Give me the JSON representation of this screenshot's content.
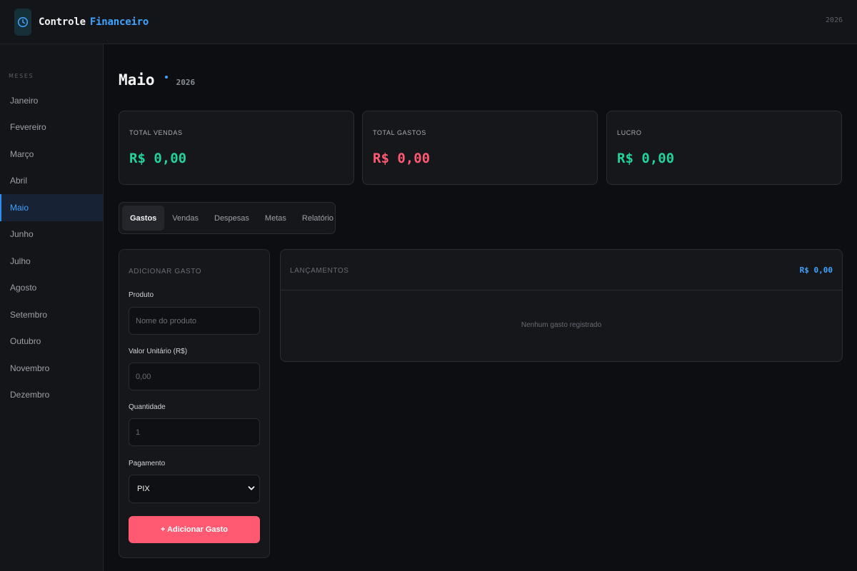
{
  "header": {
    "brand_part1": "Controle",
    "brand_part2": "Financeiro",
    "year": "2026",
    "logo_icon": "clock-icon"
  },
  "sidebar": {
    "title": "MESES",
    "months": [
      "Janeiro",
      "Fevereiro",
      "Março",
      "Abril",
      "Maio",
      "Junho",
      "Julho",
      "Agosto",
      "Setembro",
      "Outubro",
      "Novembro",
      "Dezembro"
    ],
    "active": "Maio"
  },
  "page": {
    "month": "Maio",
    "year": "2026"
  },
  "summary": {
    "vendas": {
      "label": "TOTAL VENDAS",
      "value": "R$ 0,00",
      "color": "#22d39a"
    },
    "gastos": {
      "label": "TOTAL GASTOS",
      "value": "R$ 0,00",
      "color": "#ff5a72"
    },
    "lucro": {
      "label": "LUCRO",
      "value": "R$ 0,00",
      "color": "#22d39a"
    }
  },
  "tabs": [
    "Gastos",
    "Vendas",
    "Despesas",
    "Metas",
    "Relatório"
  ],
  "active_tab": "Gastos",
  "form": {
    "title": "ADICIONAR GASTO",
    "produto_label": "Produto",
    "produto_placeholder": "Nome do produto",
    "valor_label": "Valor Unitário (R$)",
    "valor_placeholder": "0,00",
    "quantidade_label": "Quantidade",
    "quantidade_placeholder": "1",
    "pagamento_label": "Pagamento",
    "pagamento_value": "PIX",
    "submit_label": "+ Adicionar Gasto"
  },
  "list": {
    "title": "LANÇAMENTOS",
    "total": "R$ 0,00",
    "empty_text": "Nenhum gasto registrado"
  },
  "colors": {
    "accent": "#3fa3ff",
    "positive": "#22d39a",
    "negative": "#ff5a72"
  }
}
